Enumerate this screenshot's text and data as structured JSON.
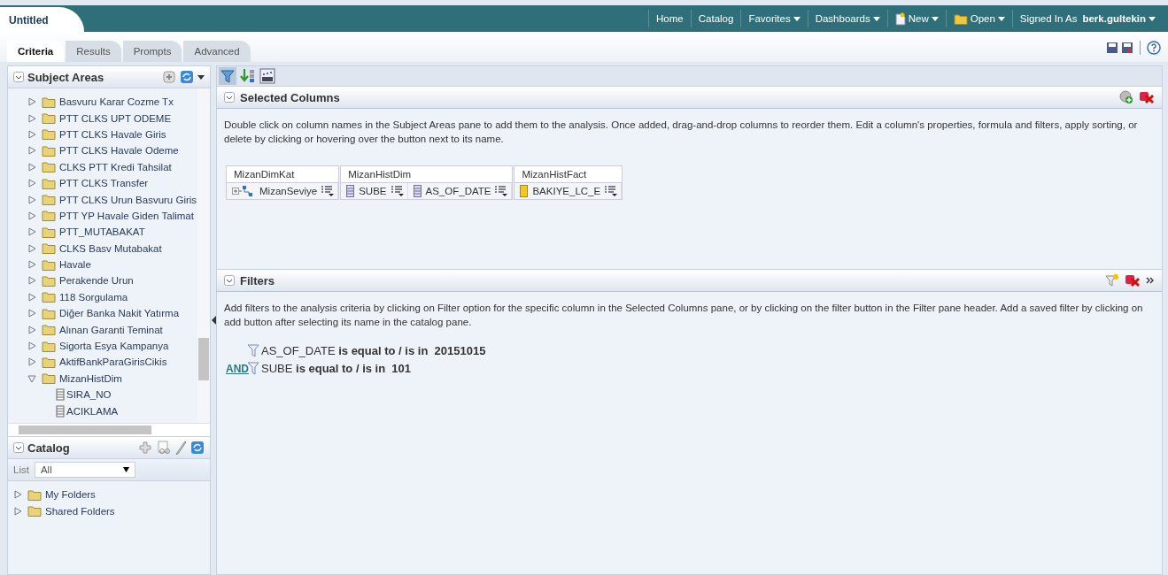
{
  "document_tab": {
    "title": "Untitled"
  },
  "top_menu": [
    {
      "label": "Home",
      "kind": "link"
    },
    {
      "label": "Catalog",
      "kind": "link"
    },
    {
      "label": "Favorites",
      "kind": "menu"
    },
    {
      "label": "Dashboards",
      "kind": "menu"
    },
    {
      "label": "New",
      "kind": "new"
    },
    {
      "label": "Open",
      "kind": "open"
    }
  ],
  "signed_in": {
    "prefix": "Signed In As",
    "user": "berk.gultekin"
  },
  "tabs": [
    {
      "label": "Criteria",
      "selected": true
    },
    {
      "label": "Results",
      "selected": false
    },
    {
      "label": "Prompts",
      "selected": false
    },
    {
      "label": "Advanced",
      "selected": false
    }
  ],
  "subject_areas": {
    "title": "Subject Areas",
    "items": [
      {
        "label": "Basvuru Karar Cozme Tx",
        "kind": "folder",
        "expanded": false
      },
      {
        "label": "PTT CLKS UPT ODEME",
        "kind": "folder",
        "expanded": false
      },
      {
        "label": "PTT CLKS Havale Giris",
        "kind": "folder",
        "expanded": false
      },
      {
        "label": "PTT CLKS Havale Odeme",
        "kind": "folder",
        "expanded": false
      },
      {
        "label": "CLKS PTT Kredi Tahsilat",
        "kind": "folder",
        "expanded": false
      },
      {
        "label": "PTT CLKS Transfer",
        "kind": "folder",
        "expanded": false
      },
      {
        "label": "PTT CLKS Urun Basvuru Giris",
        "kind": "folder",
        "expanded": false
      },
      {
        "label": "PTT YP Havale Giden Talimat",
        "kind": "folder",
        "expanded": false
      },
      {
        "label": "PTT_MUTABAKAT",
        "kind": "folder",
        "expanded": false
      },
      {
        "label": "CLKS Basv Mutabakat",
        "kind": "folder",
        "expanded": false
      },
      {
        "label": "Havale",
        "kind": "folder",
        "expanded": false
      },
      {
        "label": "Perakende Urun",
        "kind": "folder",
        "expanded": false
      },
      {
        "label": "118 Sorgulama",
        "kind": "folder",
        "expanded": false
      },
      {
        "label": "Diğer Banka Nakit Yatırma",
        "kind": "folder",
        "expanded": false
      },
      {
        "label": "Alınan Garanti Teminat",
        "kind": "folder",
        "expanded": false
      },
      {
        "label": "Sigorta Esya Kampanya",
        "kind": "folder",
        "expanded": false
      },
      {
        "label": "AktifBankParaGirisCikis",
        "kind": "folder",
        "expanded": false
      },
      {
        "label": "MizanHistDim",
        "kind": "folder",
        "expanded": true,
        "children": [
          {
            "label": "SIRA_NO",
            "kind": "column"
          },
          {
            "label": "ACIKLAMA",
            "kind": "column"
          }
        ]
      }
    ]
  },
  "catalog": {
    "title": "Catalog",
    "list_label": "List",
    "list_value": "All",
    "items": [
      {
        "label": "My Folders",
        "expanded": false
      },
      {
        "label": "Shared Folders",
        "expanded": false
      }
    ]
  },
  "selected_columns": {
    "title": "Selected Columns",
    "description": "Double click on column names in the Subject Areas pane to add them to the analysis. Once added, drag-and-drop columns to reorder them. Edit a column's properties, formula and filters, apply sorting, or delete by clicking or hovering over the button next to its name.",
    "groups": [
      {
        "name": "MizanDimKat",
        "columns": [
          {
            "label": "MizanSeviye",
            "kind": "hierarchy"
          }
        ]
      },
      {
        "name": "MizanHistDim",
        "columns": [
          {
            "label": "SUBE",
            "kind": "attribute"
          },
          {
            "label": "AS_OF_DATE",
            "kind": "attribute"
          }
        ]
      },
      {
        "name": "MizanHistFact",
        "columns": [
          {
            "label": "BAKIYE_LC_E",
            "kind": "measure"
          }
        ]
      }
    ]
  },
  "filters": {
    "title": "Filters",
    "description": "Add filters to the analysis criteria by clicking on Filter option for the specific column in the Selected Columns pane, or by clicking on the filter button in the Filter pane header. Add a saved filter by clicking on add button after selecting its name in the catalog pane.",
    "items": [
      {
        "column": "AS_OF_DATE",
        "operator": "is equal to / is in",
        "value": "20151015"
      },
      {
        "connector": "AND",
        "column": "SUBE",
        "operator": "is equal to / is in",
        "value": "101"
      }
    ]
  }
}
